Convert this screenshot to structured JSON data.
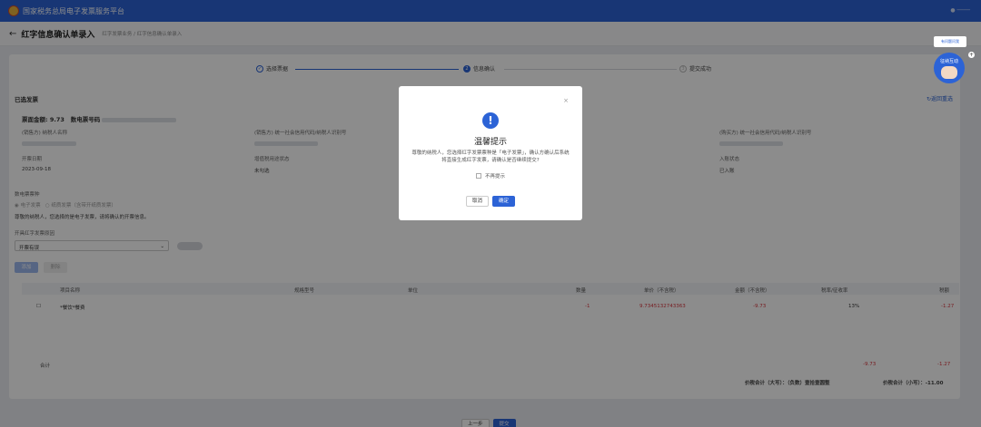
{
  "topbar": {
    "site_name": "国家税务总局电子发票服务平台"
  },
  "page": {
    "title": "红字信息确认单录入",
    "breadcrumb": "红字发票业务 / 红字信息确认单录入"
  },
  "steps": [
    {
      "label": "选择票据",
      "num": "1"
    },
    {
      "label": "信息确认",
      "num": "2"
    },
    {
      "label": "提交成功",
      "num": "3"
    }
  ],
  "section": {
    "title": "已选发票",
    "back_link": "↻返回重选",
    "amount_label": "票面金额: 9.73",
    "invoice_no_label": "数电票号码",
    "seller_name_label": "(销售方) 纳税人名称",
    "seller_tax_label": "(销售方) 统一社会信用代码/纳税人识别号",
    "buyer_tax_label": "(购买方) 统一社会信用代码/纳税人识别号",
    "issue_date_label": "开票日期",
    "issue_date": "2023-09-18",
    "usage_label": "增值税用途状态",
    "usage_value": "未勾选",
    "entry_label": "入账状态",
    "entry_value": "已入账"
  },
  "form": {
    "invoice_type_label": "数电票票种",
    "opt_electronic": "电子发票",
    "opt_paper": "纸质发票（含带开纸质发票）",
    "hint": "尊敬的纳税人，您选择的是电子发票，请将确认的开票信息。",
    "reason_label": "开具红字发票原因",
    "reason_value": "开票有误",
    "btn_add": "添加",
    "btn_del": "删除"
  },
  "table": {
    "headers": [
      "项目名称",
      "规格型号",
      "单位",
      "数量",
      "单价（不含税）",
      "金额（不含税）",
      "税率/征收率",
      "税额"
    ],
    "row": {
      "name": "*餐饮*餐费",
      "qty": "-1",
      "price": "9.7345132743363",
      "amount": "-9.73",
      "rate": "13%",
      "tax": "-1.27"
    },
    "total_label": "合计",
    "total_amount": "-9.73",
    "total_tax": "-1.27",
    "total_text": "价税合计（大写）：（负数）壹拾壹圆整",
    "total_small": "价税合计（小写）：-11.00"
  },
  "bottom": {
    "prev": "上一步",
    "submit": "提交"
  },
  "modal": {
    "close": "×",
    "title": "温馨提示",
    "message": "尊敬的纳税人，您选择红字发票票种是「电子发票」，确认方确认后系统将直接生成红字发票，请确认是否继续提交?",
    "checkbox": "不再提示",
    "cancel": "取消",
    "confirm": "确定"
  },
  "helper": {
    "bubble": "有问题问我",
    "name": "征纳互动"
  }
}
